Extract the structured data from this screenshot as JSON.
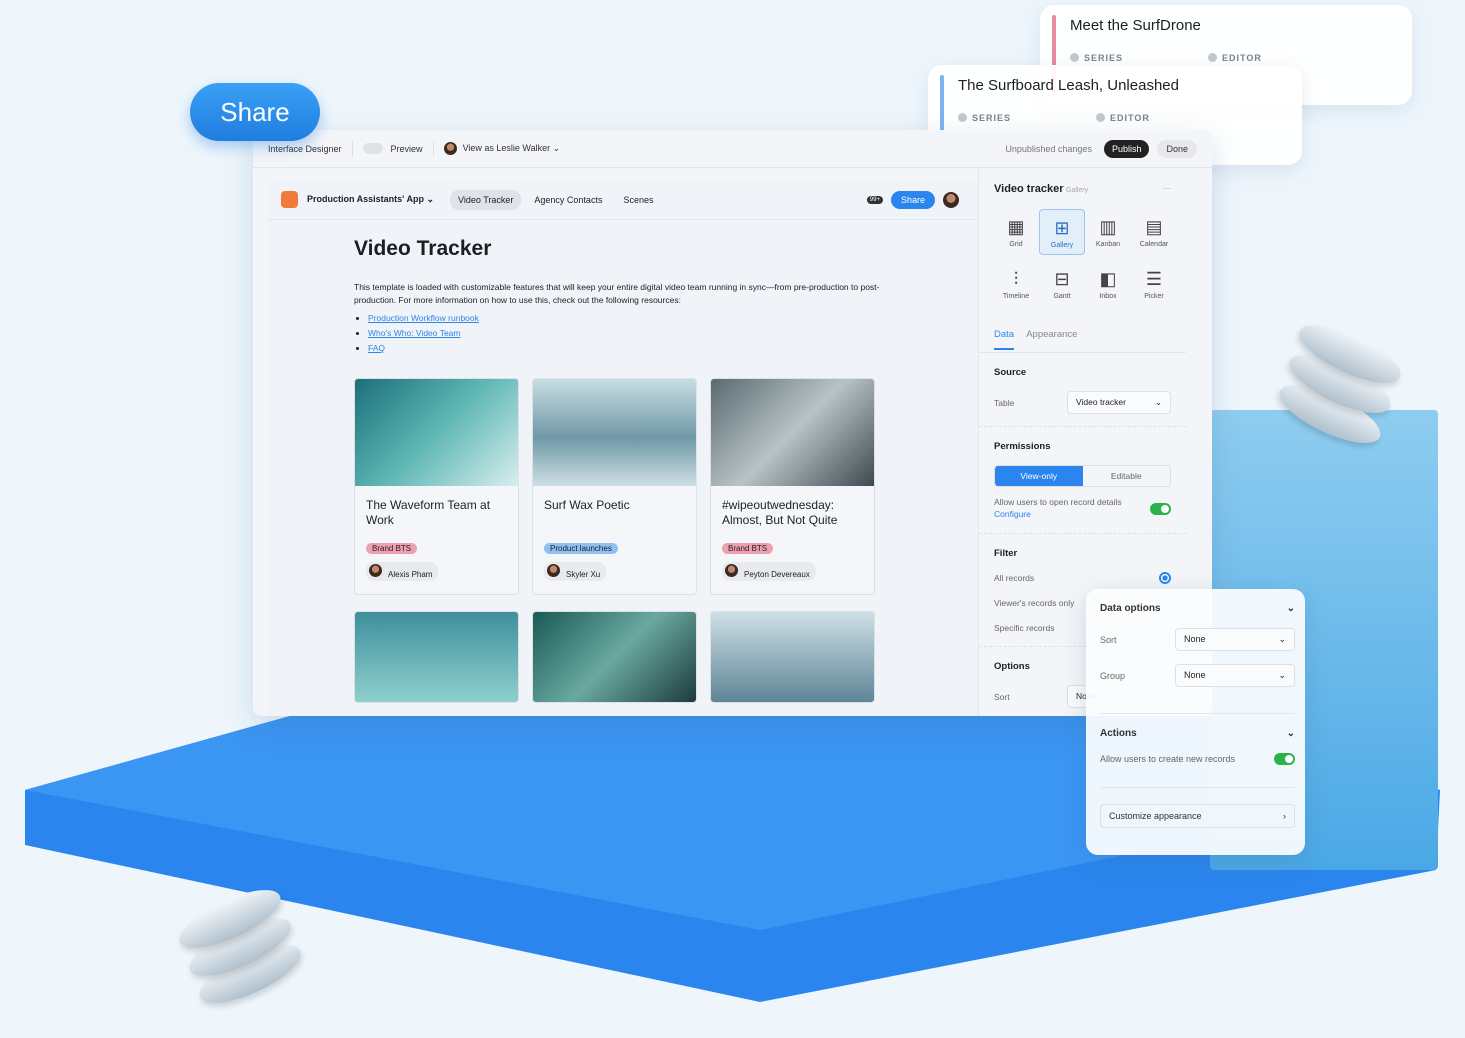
{
  "share_pill": "Share",
  "floating_cards": [
    {
      "title": "Meet the SurfDrone",
      "meta1": "SERIES",
      "meta2": "EDITOR",
      "accent": "#e98aa3"
    },
    {
      "title": "The Surfboard Leash, Unleashed",
      "meta1": "SERIES",
      "meta2": "EDITOR",
      "accent": "#7db3ef"
    }
  ],
  "topbar": {
    "title": "Interface Designer",
    "preview": "Preview",
    "view_as": "View as Leslie Walker",
    "status": "Unpublished changes",
    "publish": "Publish",
    "done": "Done"
  },
  "app": {
    "name": "Production Assistants' App",
    "tabs": [
      "Video Tracker",
      "Agency Contacts",
      "Scenes"
    ],
    "notif": "99+",
    "share": "Share"
  },
  "page": {
    "title": "Video Tracker",
    "description": "This template is loaded with customizable features that will keep your entire digital video team running in sync—from pre-production to post-production. For more information on how to use this, check out the following resources:",
    "links": [
      "Production Workflow runbook",
      "Who's Who: Video Team",
      "FAQ"
    ]
  },
  "cards": [
    {
      "title": "The Waveform Team at Work",
      "tag": "Brand BTS",
      "tag_color": "#ee9fb0",
      "person": "Alexis Pham"
    },
    {
      "title": "Surf Wax Poetic",
      "tag": "Product launches",
      "tag_color": "#8fc0f3",
      "person": "Skyler Xu"
    },
    {
      "title": "#wipeoutwednesday: Almost, But Not Quite",
      "tag": "Brand BTS",
      "tag_color": "#ee9fb0",
      "person": "Peyton Devereaux"
    }
  ],
  "panel": {
    "title": "Video tracker",
    "subtitle": "Gallery",
    "more": "···",
    "views": [
      {
        "label": "Grid",
        "icon": "▦"
      },
      {
        "label": "Gallery",
        "icon": "⊞"
      },
      {
        "label": "Kanban",
        "icon": "▥"
      },
      {
        "label": "Calendar",
        "icon": "▤"
      },
      {
        "label": "Timeline",
        "icon": "⫶"
      },
      {
        "label": "Gantt",
        "icon": "⊟"
      },
      {
        "label": "Inbox",
        "icon": "◧"
      },
      {
        "label": "Picker",
        "icon": "☰"
      }
    ],
    "tabs": [
      "Data",
      "Appearance"
    ],
    "source": {
      "heading": "Source",
      "label": "Table",
      "value": "Video tracker"
    },
    "permissions": {
      "heading": "Permissions",
      "options": [
        "View-only",
        "Editable"
      ],
      "allow": "Allow users to open record details",
      "configure": "Configure"
    },
    "filter": {
      "heading": "Filter",
      "options": [
        "All records",
        "Viewer's records only",
        "Specific records"
      ]
    },
    "options": {
      "heading": "Options",
      "sort_label": "Sort",
      "sort_value": "None"
    }
  },
  "data_options": {
    "heading": "Data options",
    "sort_label": "Sort",
    "sort_value": "None",
    "group_label": "Group",
    "group_value": "None",
    "actions": "Actions",
    "allow_create": "Allow users to create new records",
    "customize": "Customize appearance"
  }
}
